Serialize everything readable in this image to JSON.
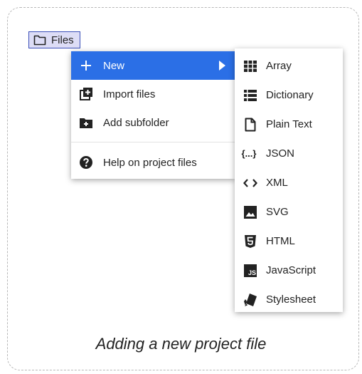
{
  "files_button": {
    "label": "Files",
    "icon": "folder-icon"
  },
  "menu": {
    "items": [
      {
        "label": "New",
        "icon": "plus-icon",
        "active": true
      },
      {
        "label": "Import files",
        "icon": "import-icon"
      },
      {
        "label": "Add subfolder",
        "icon": "add-folder-icon"
      },
      {
        "label": "Help on project files",
        "icon": "help-icon"
      }
    ]
  },
  "submenu": {
    "items": [
      {
        "label": "Array",
        "icon": "grid-icon"
      },
      {
        "label": "Dictionary",
        "icon": "list-icon"
      },
      {
        "label": "Plain Text",
        "icon": "file-icon"
      },
      {
        "label": "JSON",
        "icon": "braces-icon",
        "icon_text": "{...}"
      },
      {
        "label": "XML",
        "icon": "code-icon"
      },
      {
        "label": "SVG",
        "icon": "image-icon"
      },
      {
        "label": "HTML",
        "icon": "html5-icon"
      },
      {
        "label": "JavaScript",
        "icon": "js-icon",
        "icon_text": "JS"
      },
      {
        "label": "Stylesheet",
        "icon": "brush-icon"
      }
    ]
  },
  "caption": "Adding a new project file",
  "colors": {
    "accent": "#2b6fe6",
    "files_bg": "#ddddf6",
    "files_border": "#3b4fb8"
  }
}
